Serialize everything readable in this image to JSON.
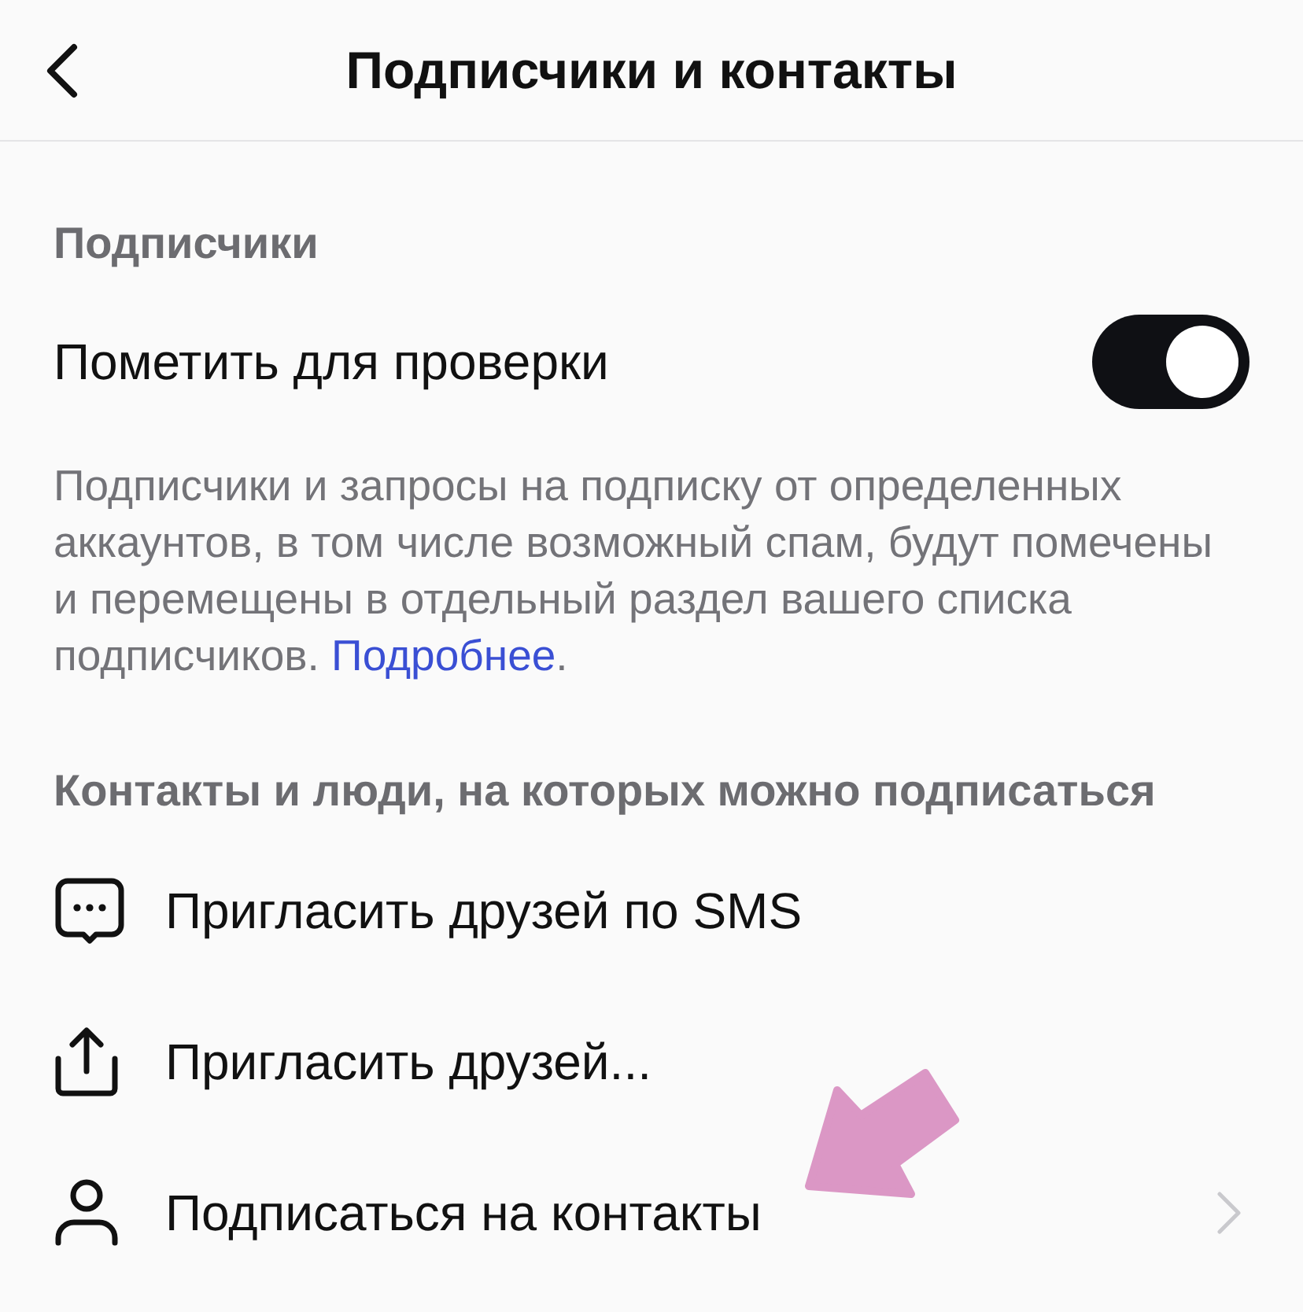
{
  "header": {
    "title": "Подписчики и контакты"
  },
  "followers_section": {
    "heading": "Подписчики",
    "toggle": {
      "label": "Пометить для проверки",
      "on": true
    },
    "description": {
      "text": "Подписчики и запросы на подписку от определенных аккаунтов, в том числе возможный спам, будут помечены и перемещены в отдельный раздел вашего списка подписчиков. ",
      "link": "Подробнее",
      "after": "."
    }
  },
  "contacts_section": {
    "heading": "Контакты и люди, на которых можно подписаться",
    "items": [
      {
        "kind": "sms",
        "label": "Пригласить друзей по SMS",
        "chevron": false
      },
      {
        "kind": "share",
        "label": "Пригласить друзей...",
        "chevron": false
      },
      {
        "kind": "contacts",
        "label": "Подписаться на контакты",
        "chevron": true
      }
    ]
  },
  "annotation": {
    "kind": "arrow"
  }
}
